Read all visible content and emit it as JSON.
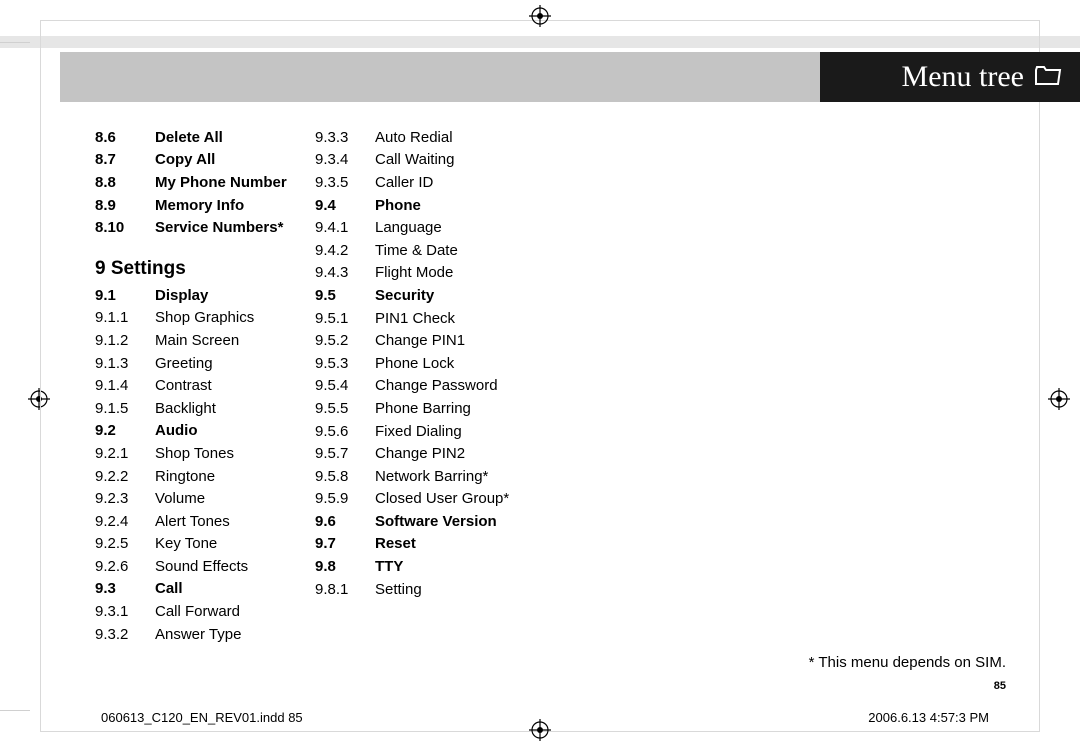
{
  "header": {
    "title": "Menu tree"
  },
  "col1": [
    {
      "n": "8.6",
      "l": "Delete All",
      "bold": true
    },
    {
      "n": "8.7",
      "l": "Copy All",
      "bold": true
    },
    {
      "n": "8.8",
      "l": "My Phone Number",
      "bold": true
    },
    {
      "n": "8.9",
      "l": "Memory Info",
      "bold": true
    },
    {
      "n": "8.10",
      "l": "Service Numbers*",
      "bold": true
    }
  ],
  "section_head": "9 Settings",
  "col1b": [
    {
      "n": "9.1",
      "l": "Display",
      "bold": true
    },
    {
      "n": "9.1.1",
      "l": "Shop Graphics",
      "bold": false
    },
    {
      "n": "9.1.2",
      "l": "Main Screen",
      "bold": false
    },
    {
      "n": "9.1.3",
      "l": "Greeting",
      "bold": false
    },
    {
      "n": "9.1.4",
      "l": "Contrast",
      "bold": false
    },
    {
      "n": "9.1.5",
      "l": "Backlight",
      "bold": false
    },
    {
      "n": "9.2",
      "l": "Audio",
      "bold": true
    },
    {
      "n": "9.2.1",
      "l": "Shop Tones",
      "bold": false
    },
    {
      "n": "9.2.2",
      "l": "Ringtone",
      "bold": false
    },
    {
      "n": "9.2.3",
      "l": "Volume",
      "bold": false
    },
    {
      "n": "9.2.4",
      "l": "Alert Tones",
      "bold": false
    },
    {
      "n": "9.2.5",
      "l": "Key Tone",
      "bold": false
    },
    {
      "n": "9.2.6",
      "l": "Sound Effects",
      "bold": false
    },
    {
      "n": "9.3",
      "l": "Call",
      "bold": true
    },
    {
      "n": "9.3.1",
      "l": "Call Forward",
      "bold": false
    },
    {
      "n": "9.3.2",
      "l": "Answer Type",
      "bold": false
    }
  ],
  "col2": [
    {
      "n": "9.3.3",
      "l": "Auto Redial",
      "bold": false
    },
    {
      "n": "9.3.4",
      "l": "Call Waiting",
      "bold": false
    },
    {
      "n": "9.3.5",
      "l": "Caller ID",
      "bold": false
    },
    {
      "n": "9.4",
      "l": "Phone",
      "bold": true
    },
    {
      "n": "9.4.1",
      "l": "Language",
      "bold": false
    },
    {
      "n": "9.4.2",
      "l": "Time & Date",
      "bold": false
    },
    {
      "n": "9.4.3",
      "l": "Flight Mode",
      "bold": false
    },
    {
      "n": "9.5",
      "l": "Security",
      "bold": true
    },
    {
      "n": "9.5.1",
      "l": "PIN1 Check",
      "bold": false
    },
    {
      "n": "9.5.2",
      "l": "Change PIN1",
      "bold": false
    },
    {
      "n": "9.5.3",
      "l": "Phone Lock",
      "bold": false
    },
    {
      "n": "9.5.4",
      "l": "Change Password",
      "bold": false
    },
    {
      "n": "9.5.5",
      "l": "Phone Barring",
      "bold": false
    },
    {
      "n": "9.5.6",
      "l": "Fixed Dialing",
      "bold": false
    },
    {
      "n": "9.5.7",
      "l": "Change PIN2",
      "bold": false
    },
    {
      "n": "9.5.8",
      "l": "Network Barring*",
      "bold": false
    },
    {
      "n": "9.5.9",
      "l": "Closed User Group*",
      "bold": false
    },
    {
      "n": "9.6",
      "l": "Software Version",
      "bold": true
    },
    {
      "n": "9.7",
      "l": "Reset",
      "bold": true
    },
    {
      "n": "9.8",
      "l": "TTY",
      "bold": true
    },
    {
      "n": "9.8.1",
      "l": "Setting",
      "bold": false
    }
  ],
  "footnote": "* This menu depends on SIM.",
  "page_number": "85",
  "footer": {
    "left": "060613_C120_EN_REV01.indd   85",
    "right": "2006.6.13   4:57:3 PM"
  }
}
